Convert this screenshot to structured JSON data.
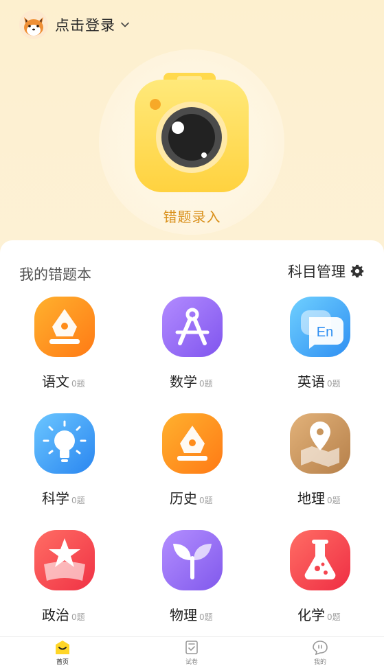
{
  "header": {
    "login_text": "点击登录",
    "avatar_icon": "fox-avatar-icon",
    "dropdown_icon": "chevron-down-icon"
  },
  "hero": {
    "label": "错题录入",
    "icon": "camera-icon",
    "accent_color": "#d9901b"
  },
  "notebook": {
    "title": "我的错题本",
    "manage_label": "科目管理",
    "manage_icon": "gear-icon",
    "subjects": [
      {
        "name": "语文",
        "count": "0题",
        "icon": "pen-nib-icon",
        "color": "#ff8c1a"
      },
      {
        "name": "数学",
        "count": "0题",
        "icon": "compass-icon",
        "color": "#9a72f5"
      },
      {
        "name": "英语",
        "count": "0题",
        "icon": "english-bubble-icon",
        "color": "#43a8f5"
      },
      {
        "name": "科学",
        "count": "0题",
        "icon": "lightbulb-icon",
        "color": "#3ea3f7"
      },
      {
        "name": "历史",
        "count": "0题",
        "icon": "pen-nib-icon",
        "color": "#ff8c1a"
      },
      {
        "name": "地理",
        "count": "0题",
        "icon": "map-pin-icon",
        "color": "#c8955c"
      },
      {
        "name": "政治",
        "count": "0题",
        "icon": "star-banner-icon",
        "color": "#f5454f"
      },
      {
        "name": "物理",
        "count": "0题",
        "icon": "sprout-icon",
        "color": "#9f78f2"
      },
      {
        "name": "化学",
        "count": "0题",
        "icon": "flask-icon",
        "color": "#f5454f"
      }
    ]
  },
  "bottom_nav": [
    {
      "label": "首页",
      "icon": "home-smile-icon",
      "active": true
    },
    {
      "label": "试卷",
      "icon": "exam-paper-icon",
      "active": false
    },
    {
      "label": "我的",
      "icon": "profile-bubble-icon",
      "active": false
    }
  ]
}
